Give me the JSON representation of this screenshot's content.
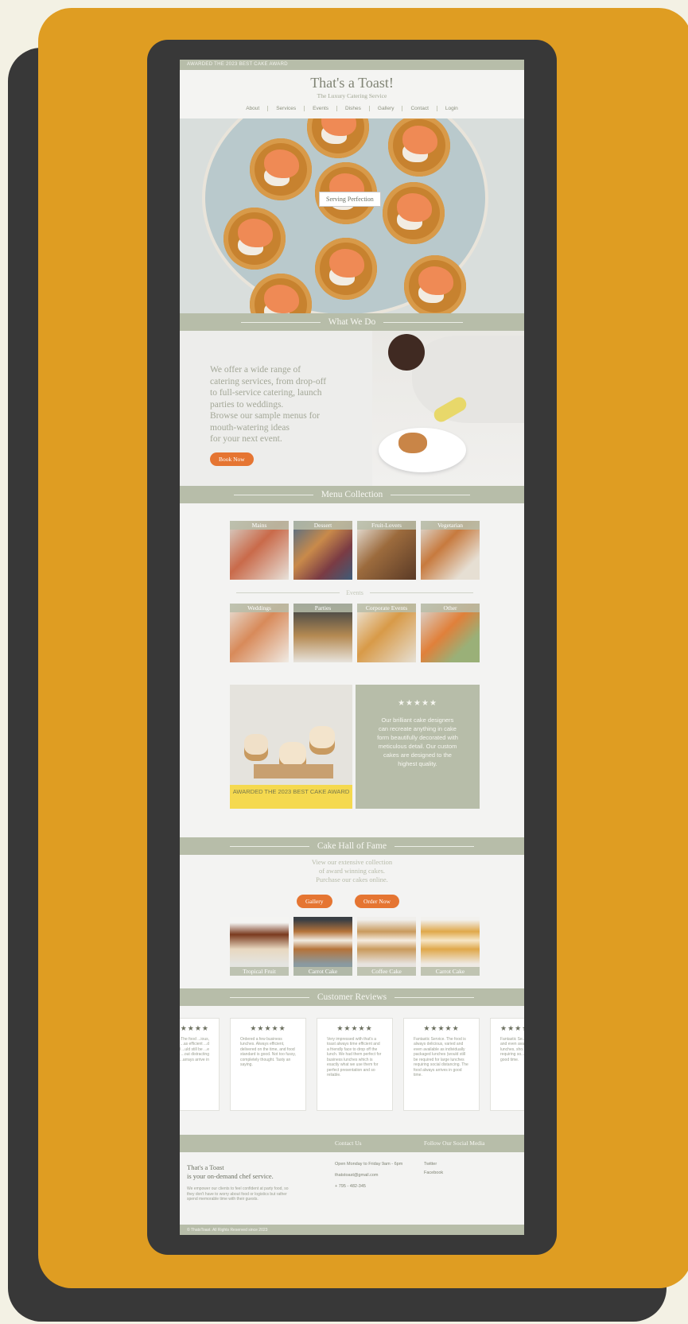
{
  "top_bar": {
    "text": "AWARDED THE 2023 BEST CAKE AWARD"
  },
  "header": {
    "brand": "That's a Toast!",
    "tagline": "The Luxury Catering Service"
  },
  "nav": {
    "items": [
      "About",
      "Services",
      "Events",
      "Dishes",
      "Gallery",
      "Contact",
      "Login"
    ]
  },
  "hero": {
    "tag": "Serving Perfection"
  },
  "what_we_do": {
    "heading": "What We Do",
    "lines": [
      "We offer a wide range of",
      "catering services, from drop-off",
      "to full-service catering, launch",
      "parties to weddings.",
      "Browse our sample menus for",
      "mouth-watering ideas",
      "for your next event."
    ],
    "button": "Book Now"
  },
  "menu": {
    "heading": "Menu Collection",
    "items": [
      "Mains",
      "Dessert",
      "Fruit-Lovers",
      "Vegetarian"
    ],
    "events_label": "Events",
    "events": [
      "Weddings",
      "Parties",
      "Corporate Events",
      "Other"
    ]
  },
  "award": {
    "banner": "AWARDED THE 2023 BEST CAKE AWARD",
    "stars": "★★★★★",
    "text": "Our brilliant cake designers can recreate anything in cake form beautifully decorated with meticulous detail. Our custom cakes are designed to the highest quality."
  },
  "hall_of_fame": {
    "heading": "Cake Hall of Fame",
    "lines": [
      "View our extensive collection",
      "of award winning cakes.",
      "Purchase our cakes online."
    ],
    "gallery_button": "Gallery",
    "order_button": "Order Now",
    "cakes": [
      "Tropical Fruit",
      "Carrot Cake",
      "Coffee Cake",
      "Carrot Cake"
    ]
  },
  "reviews": {
    "heading": "Customer Reviews",
    "stars": "★★★★★",
    "cards": [
      "...ience, The food ...ious, arrived ...as efficient ...d packaged ...uld still be ...e larger lunches ...out distracting ...arrays arrive in",
      "Ordered a few business lunches. Always efficient, delivered on the time, and food standard is good. Not too fussy, completely thought. Tasty an saying.",
      "Very impressed with that's a toast always time efficient and a friendly face to drop off the lunch. We had them perfect for business lunches which is exactly what we use them for perfect presentation and so reliable.",
      "Fantastic Service. The food is always delicious, varied and even available as individually packaged lunches (would still be required for large lunches requiring social distancing. The food always arrives in good time.",
      "Fantastic Se... is always va... and even ava... individually... lunches, sho... required for... requiring so... The food als... good time."
    ]
  },
  "footer": {
    "contact_heading": "Contact Us",
    "social_heading": "Follow Our Social Media",
    "brand_line1": "That's a Toast",
    "brand_line2": "is your on-demand chef service.",
    "blurb": "We empower our clients to feel confident at party food, so they don't have to worry about food or logistics but rather spend memorable time with their guests.",
    "hours": "Open Monday to Friday 9am - 6pm",
    "email": "thatstoast@gmail.com",
    "phone": "+ 795 - 482-345",
    "social": [
      "Twitter",
      "Facebook"
    ],
    "copyright": "© ThatsToast. All Rights Reserved since 2023"
  }
}
